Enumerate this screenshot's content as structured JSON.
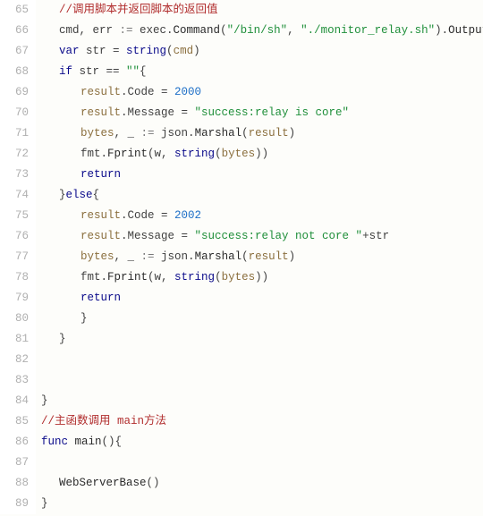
{
  "gutter": {
    "start": 65,
    "end": 89
  },
  "code": {
    "l65": {
      "comment": "//调用脚本并返回脚本的返回值"
    },
    "l66": {
      "a": "cmd, err ",
      "op1": ":=",
      "b": " exec.",
      "fn": "Command",
      "p1": "(",
      "s1": "\"/bin/sh\"",
      "c1": ", ",
      "s2": "\"./monitor_relay.sh\"",
      "p2": ").",
      "fn2": "Output",
      "p3": "()"
    },
    "l67": {
      "kw": "var",
      "a": " str = ",
      "ty": "string",
      "p1": "(",
      "id": "cmd",
      "p2": ")"
    },
    "l68": {
      "kw": "if",
      "a": " str == ",
      "s": "\"\"",
      "p": "{"
    },
    "l69": {
      "id": "result",
      "dot": ".Code = ",
      "num": "2000"
    },
    "l70": {
      "id": "result",
      "dot": ".Message = ",
      "s": "\"success:relay is core\""
    },
    "l71": {
      "id1": "bytes",
      "a": ", _ ",
      "op": ":=",
      "b": " json.",
      "fn": "Marshal",
      "p1": "(",
      "id2": "result",
      "p2": ")"
    },
    "l72": {
      "a": "fmt.",
      "fn": "Fprint",
      "p1": "(w, ",
      "ty": "string",
      "p2": "(",
      "id": "bytes",
      "p3": "))"
    },
    "l73": {
      "kw": "return"
    },
    "l74": {
      "a": "}",
      "kw": "else",
      "b": "{"
    },
    "l75": {
      "id": "result",
      "dot": ".Code = ",
      "num": "2002"
    },
    "l76": {
      "id": "result",
      "dot": ".Message = ",
      "s": "\"success:relay not core \"",
      "plus": "+str"
    },
    "l77": {
      "id1": "bytes",
      "a": ", _ ",
      "op": ":=",
      "b": " json.",
      "fn": "Marshal",
      "p1": "(",
      "id2": "result",
      "p2": ")"
    },
    "l78": {
      "a": "fmt.",
      "fn": "Fprint",
      "p1": "(w, ",
      "ty": "string",
      "p2": "(",
      "id": "bytes",
      "p3": "))"
    },
    "l79": {
      "kw": "return"
    },
    "l80": {
      "brace": "}"
    },
    "l81": {
      "brace": "}"
    },
    "l82": {
      "blank": ""
    },
    "l83": {
      "blank": ""
    },
    "l84": {
      "brace": "}"
    },
    "l85": {
      "comment": "//主函数调用 main方法"
    },
    "l86": {
      "kw": "func",
      "a": " ",
      "fn": "main",
      "p": "(){"
    },
    "l87": {
      "blank": ""
    },
    "l88": {
      "fn": "WebServerBase",
      "p": "()"
    },
    "l89": {
      "brace": "}"
    }
  }
}
